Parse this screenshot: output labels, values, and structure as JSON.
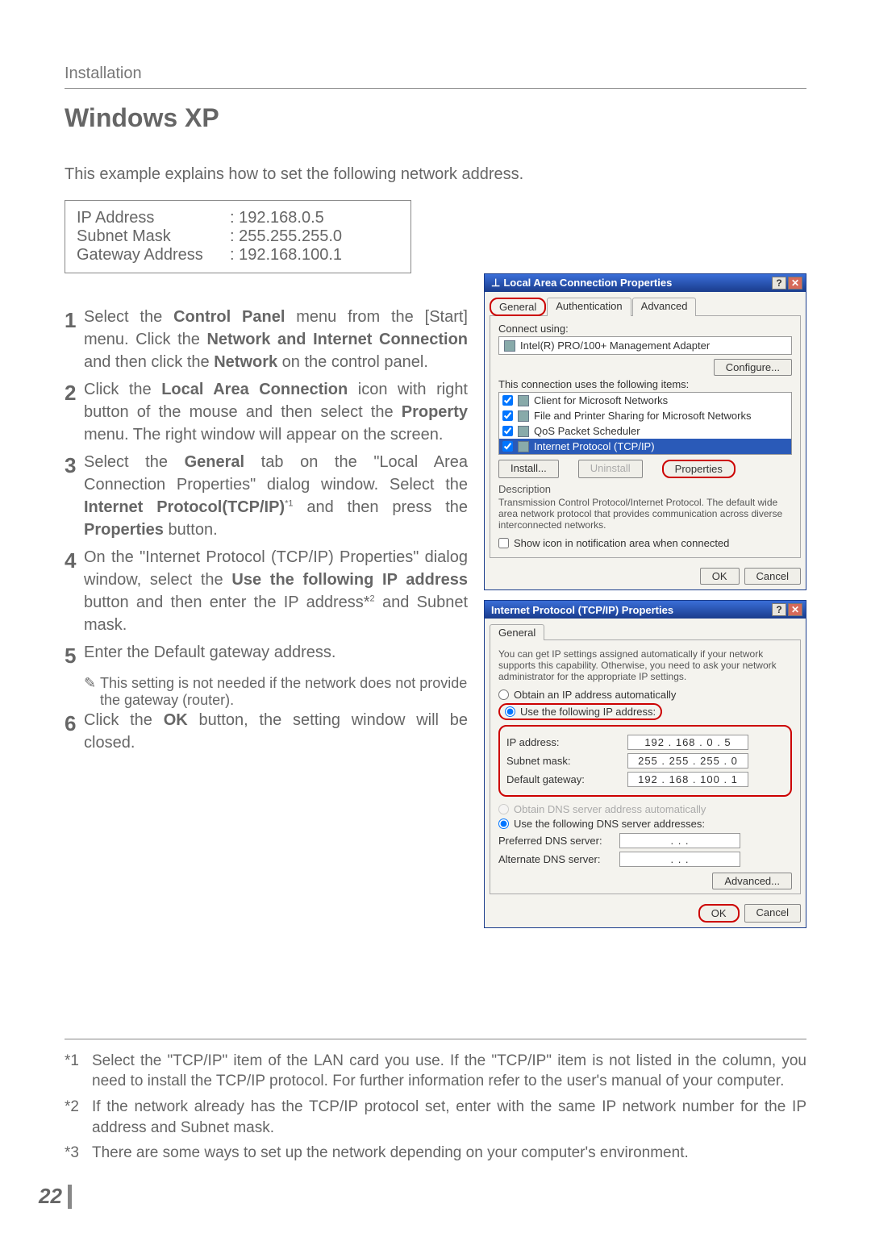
{
  "chapter": "Installation",
  "section_title": "Windows XP",
  "intro": "This example explains how to set the following network address.",
  "addr": {
    "ip_label": "IP Address",
    "ip_val": ": 192.168.0.5",
    "mask_label": "Subnet Mask",
    "mask_val": ": 255.255.255.0",
    "gw_label": "Gateway Address",
    "gw_val": ": 192.168.100.1"
  },
  "steps": {
    "s1a": "Select the ",
    "s1b": "Control Panel",
    "s1c": " menu from the [Start] menu. Click the ",
    "s1d": "Network and Internet Connection",
    "s1e": " and then click the ",
    "s1f": "Network",
    "s1g": " on the control panel.",
    "s2a": "Click the ",
    "s2b": "Local Area Connection",
    "s2c": " icon with right button of the mouse and then select the ",
    "s2d": "Property",
    "s2e": " menu. The right window will appear on the screen.",
    "s3a": "Select the ",
    "s3b": "General",
    "s3c": " tab on the \"Local Area Connection Properties\" dialog window. Select the ",
    "s3d": "Internet Protocol(TCP/IP)",
    "s3e": " and then press the ",
    "s3f": "Properties",
    "s3g": " button.",
    "s4a": "On the \"Internet Protocol (TCP/IP) Properties\" dialog window, select the ",
    "s4b": "Use the following IP address",
    "s4c": " button and then enter the IP address*",
    "s4d": " and Subnet mask.",
    "s5": "Enter the Default gateway address.",
    "s5n": "This setting is not needed if the network does not provide the gateway (router).",
    "s6a": "Click the ",
    "s6b": "OK",
    "s6c": " button, the setting window will be closed."
  },
  "sup1": "*1",
  "sup2": "2",
  "dlg1": {
    "title": "Local Area Connection Properties",
    "tab_general": "General",
    "tab_auth": "Authentication",
    "tab_adv": "Advanced",
    "connect_using": "Connect using:",
    "adapter": "Intel(R) PRO/100+ Management Adapter",
    "configure": "Configure...",
    "uses_items": "This connection uses the following items:",
    "item1": "Client for Microsoft Networks",
    "item2": "File and Printer Sharing for Microsoft Networks",
    "item3": "QoS Packet Scheduler",
    "item4": "Internet Protocol (TCP/IP)",
    "install": "Install...",
    "uninstall": "Uninstall",
    "properties": "Properties",
    "desc_label": "Description",
    "desc": "Transmission Control Protocol/Internet Protocol. The default wide area network protocol that provides communication across diverse interconnected networks.",
    "show_icon": "Show icon in notification area when connected",
    "ok": "OK",
    "cancel": "Cancel"
  },
  "dlg2": {
    "title": "Internet Protocol (TCP/IP) Properties",
    "tab_general": "General",
    "blurb": "You can get IP settings assigned automatically if your network supports this capability. Otherwise, you need to ask your network administrator for the appropriate IP settings.",
    "r_auto": "Obtain an IP address automatically",
    "r_use": "Use the following IP address:",
    "ip_lbl": "IP address:",
    "ip_val": "192 . 168 .   0 .   5",
    "mask_lbl": "Subnet mask:",
    "mask_val": "255 . 255 . 255 .   0",
    "gw_lbl": "Default gateway:",
    "gw_val": "192 . 168 . 100 .   1",
    "r_dns_auto": "Obtain DNS server address automatically",
    "r_dns_use": "Use the following DNS server addresses:",
    "pref_dns": "Preferred DNS server:",
    "alt_dns": "Alternate DNS server:",
    "dns_blank": ".       .       .",
    "advanced": "Advanced...",
    "ok": "OK",
    "cancel": "Cancel"
  },
  "footnotes": {
    "f1n": "*1",
    "f1": "Select the \"TCP/IP\" item of the LAN card you use. If the \"TCP/IP\" item is not listed in the column, you need to install the TCP/IP protocol. For further information refer to the user's manual of your computer.",
    "f2n": "*2",
    "f2": "If the network already has the TCP/IP protocol set, enter with the same IP network number for the IP address and Subnet mask.",
    "f3n": "*3",
    "f3": "There are some ways to set up the network depending on your computer's environment."
  },
  "page": "22"
}
